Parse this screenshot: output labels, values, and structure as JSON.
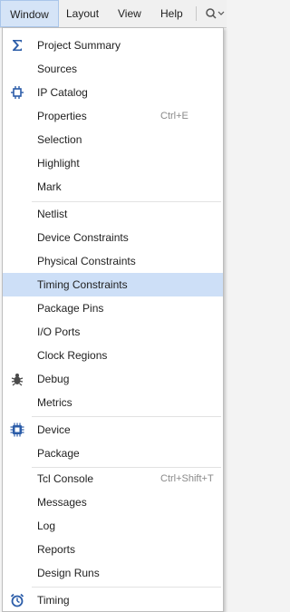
{
  "menubar": {
    "window": "Window",
    "layout": "Layout",
    "view": "View",
    "help": "Help",
    "search_icon": "search-icon"
  },
  "menu": {
    "items": [
      {
        "label": "Project Summary",
        "icon": "sigma-icon"
      },
      {
        "label": "Sources"
      },
      {
        "label": "IP Catalog",
        "icon": "ip-chip-icon"
      },
      {
        "label": "Properties",
        "shortcut": "Ctrl+E"
      },
      {
        "label": "Selection"
      },
      {
        "label": "Highlight"
      },
      {
        "label": "Mark"
      },
      {
        "label": "Netlist"
      },
      {
        "label": "Device Constraints"
      },
      {
        "label": "Physical Constraints"
      },
      {
        "label": "Timing Constraints",
        "selected": true
      },
      {
        "label": "Package Pins"
      },
      {
        "label": "I/O Ports"
      },
      {
        "label": "Clock Regions"
      },
      {
        "label": "Debug",
        "icon": "bug-icon"
      },
      {
        "label": "Metrics"
      },
      {
        "label": "Device",
        "icon": "device-chip-icon"
      },
      {
        "label": "Package"
      },
      {
        "label": "Tcl Console",
        "shortcut": "Ctrl+Shift+T"
      },
      {
        "label": "Messages"
      },
      {
        "label": "Log"
      },
      {
        "label": "Reports"
      },
      {
        "label": "Design Runs"
      },
      {
        "label": "Timing",
        "icon": "alarm-clock-icon"
      }
    ]
  },
  "colors": {
    "selection_bg": "#cddff7",
    "menubar_active_bg": "#d5e4f7",
    "icon_blue": "#2b5ca8"
  }
}
